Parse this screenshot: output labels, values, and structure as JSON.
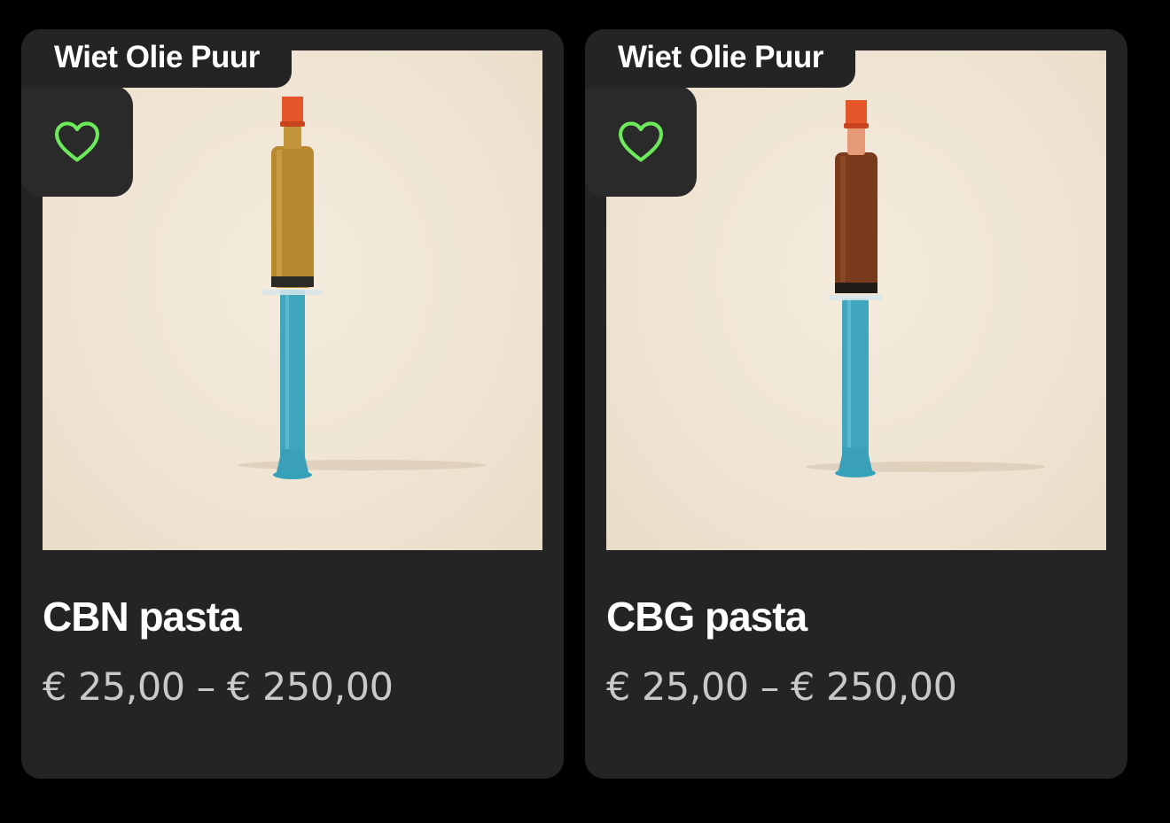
{
  "products": [
    {
      "brand": "Wiet Olie Puur",
      "title": "CBN pasta",
      "price": "€ 25,00 – € 250,00",
      "wishlist_icon": "heart-outline-icon",
      "syringe_fill_color": "#b8892f"
    },
    {
      "brand": "Wiet Olie Puur",
      "title": "CBG pasta",
      "price": "€ 25,00 – € 250,00",
      "wishlist_icon": "heart-outline-icon",
      "syringe_fill_color": "#7a3a1c"
    }
  ],
  "colors": {
    "background": "#000000",
    "card": "#242424",
    "heart": "#6dea5b",
    "price": "#c9c9c9",
    "syringe_plunger": "#3fa6bd",
    "syringe_cap": "#e4562a"
  }
}
